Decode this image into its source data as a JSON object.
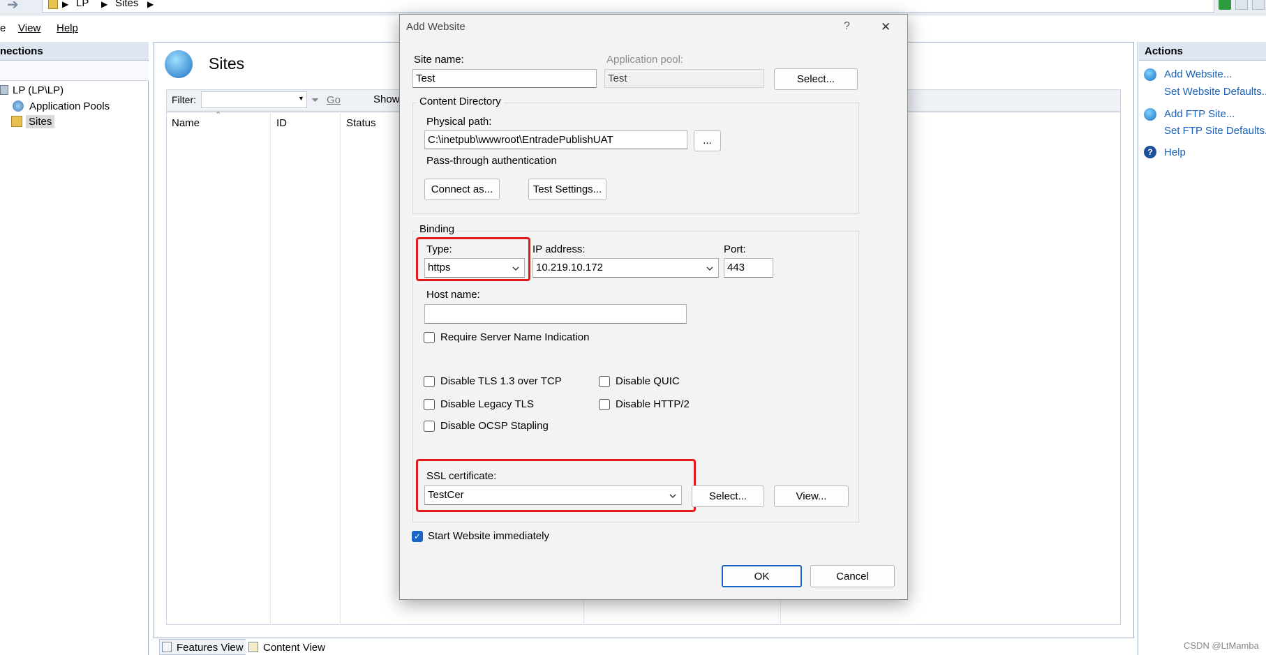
{
  "breadcrumb": [
    "LP",
    "Sites"
  ],
  "menu": {
    "file": "e",
    "view": "View",
    "help": "Help"
  },
  "connections": {
    "header": "nections",
    "tree": {
      "server": "LP (LP\\LP)",
      "app_pools": "Application Pools",
      "sites": "Sites"
    }
  },
  "center": {
    "title": "Sites",
    "filter_label": "Filter:",
    "go_label": "Go",
    "show_label": "Show",
    "columns": [
      "Name",
      "ID",
      "Status"
    ],
    "tabs": {
      "features": "Features View",
      "content": "Content View"
    }
  },
  "actions": {
    "header": "Actions",
    "items": [
      "Add Website...",
      "Set Website Defaults...",
      "Add FTP Site...",
      "Set FTP Site Defaults...",
      "Help"
    ]
  },
  "dialog": {
    "title": "Add Website",
    "help_glyph": "?",
    "close_glyph": "✕",
    "site_name_label": "Site name:",
    "site_name_value": "Test",
    "app_pool_label": "Application pool:",
    "app_pool_value": "Test",
    "select_pool_button": "Select...",
    "content_group": "Content Directory",
    "physical_path_label": "Physical path:",
    "physical_path_value": "C:\\inetpub\\wwwroot\\EntradePublishUAT",
    "browse_button": "...",
    "passthrough_label": "Pass-through authentication",
    "connect_as_button": "Connect as...",
    "test_settings_button": "Test Settings...",
    "binding_group": "Binding",
    "type_label": "Type:",
    "type_value": "https",
    "ip_label": "IP address:",
    "ip_value": "10.219.10.172",
    "port_label": "Port:",
    "port_value": "443",
    "host_label": "Host name:",
    "host_value": "",
    "sni_label": "Require Server Name Indication",
    "tls13_label": "Disable TLS 1.3 over TCP",
    "quic_label": "Disable QUIC",
    "legacy_tls_label": "Disable Legacy TLS",
    "http2_label": "Disable HTTP/2",
    "ocsp_label": "Disable OCSP Stapling",
    "ssl_label": "SSL certificate:",
    "ssl_value": "TestCer",
    "ssl_select_button": "Select...",
    "ssl_view_button": "View...",
    "start_label": "Start Website immediately",
    "start_checked": true,
    "ok_button": "OK",
    "cancel_button": "Cancel"
  },
  "watermark": "CSDN @LtMamba",
  "colors": {
    "highlight_red": "#e01a1a",
    "accent_blue": "#1a64c8",
    "link_blue": "#1a5fb4"
  }
}
